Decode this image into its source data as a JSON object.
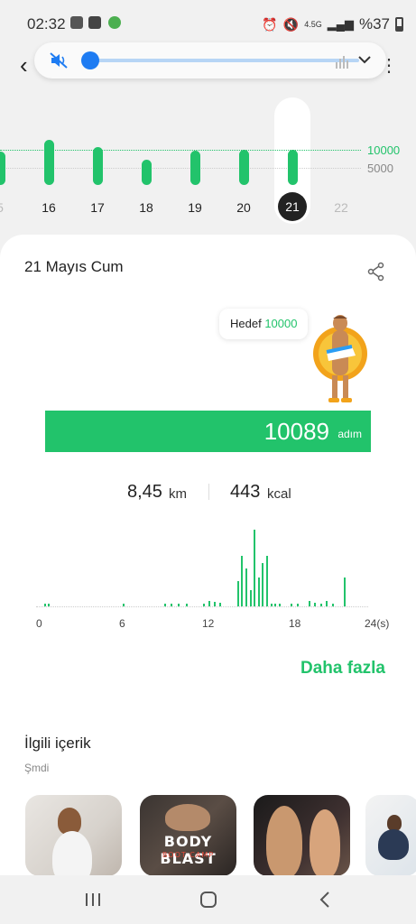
{
  "status_bar": {
    "time": "02:32",
    "network": "4.5G",
    "battery": "%37"
  },
  "week_chart": {
    "goal_label": "10000",
    "ref_label": "5000",
    "days": [
      "5",
      "16",
      "17",
      "18",
      "19",
      "20",
      "21",
      "22"
    ],
    "selected_day": "21",
    "values": [
      9500,
      12800,
      10800,
      7300,
      9700,
      10000,
      10089,
      0
    ]
  },
  "card": {
    "date_title": "21 Mayıs Cum",
    "goal_prefix": "Hedef",
    "goal_value": "10000",
    "steps_value": "10089",
    "steps_unit": "adım",
    "distance_value": "8,45",
    "distance_unit": "km",
    "kcal_value": "443",
    "kcal_unit": "kcal",
    "more_link": "Daha fazla"
  },
  "hourly_chart": {
    "x_labels": [
      "0",
      "6",
      "12",
      "18",
      "24(s)"
    ],
    "hours": [
      0.3,
      0.6,
      6,
      9,
      9.5,
      10,
      10.6,
      11.8,
      12.2,
      12.6,
      13,
      14.3,
      14.6,
      14.9,
      15.2,
      15.5,
      15.8,
      16.1,
      16.4,
      16.7,
      17,
      17.3,
      18.2,
      18.6,
      19.5,
      19.9,
      20.3,
      20.7,
      21.2,
      22
    ],
    "values": [
      3,
      3,
      3,
      3,
      3,
      3,
      3,
      3,
      6,
      5,
      4,
      28,
      56,
      42,
      18,
      85,
      32,
      48,
      56,
      3,
      3,
      3,
      3,
      3,
      6,
      4,
      3,
      6,
      3,
      32
    ]
  },
  "related": {
    "title": "İlgili içerik",
    "subtitle": "Şmdi",
    "thumb2_line1": "BODY BLAST",
    "thumb2_line2": "BOOT CAMP"
  }
}
